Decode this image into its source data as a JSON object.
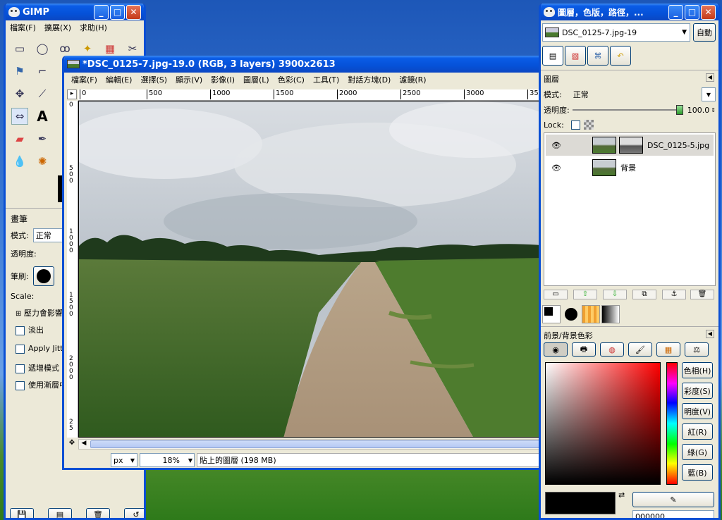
{
  "toolbox": {
    "title": "GIMP",
    "menu": [
      "檔案(F)",
      "擴展(X)",
      "求助(H)"
    ],
    "tool_icons": [
      "rect-select-icon",
      "ellipse-select-icon",
      "lasso-icon",
      "fuzzy-select-icon",
      "color-select-icon",
      "scissors-icon",
      "move-icon",
      "align-icon",
      "crop-icon",
      "rotate-icon",
      "scale-icon",
      "shear-icon",
      "flip-icon",
      "text-icon",
      "bucket-fill-icon",
      "blend-icon",
      "pencil-icon",
      "paintbrush-icon",
      "eraser-icon",
      "airbrush-icon",
      "ink-icon",
      "clone-icon",
      "heal-icon",
      "smudge-icon",
      "dodge-icon",
      "blur-icon",
      "measure-icon",
      "zoom-icon"
    ],
    "tool_options": {
      "title": "畫筆",
      "mode_label": "模式:",
      "mode_value": "正常",
      "opacity_label": "透明度:",
      "brush_label": "筆刷:",
      "scale_label": "Scale:",
      "pressure_label": "壓力會影響",
      "fade_label": "淡出",
      "jitter_label": "Apply Jitte",
      "incremental_label": "遞增模式",
      "color_from_gradient_label": "使用漸層中"
    }
  },
  "image_window": {
    "title": "*DSC_0125-7.jpg-19.0 (RGB, 3 layers) 3900x2613",
    "menu": [
      "檔案(F)",
      "編輯(E)",
      "選擇(S)",
      "顯示(V)",
      "影像(I)",
      "圖層(L)",
      "色彩(C)",
      "工具(T)",
      "對話方塊(D)",
      "濾鏡(R)"
    ],
    "ruler_ticks": [
      "0",
      "500",
      "1000",
      "1500",
      "2000",
      "2500",
      "3000",
      "35"
    ],
    "ruler_v_ticks": [
      "0",
      "5\n0\n0",
      "1\n0\n0\n0",
      "1\n5\n0\n0",
      "2\n0\n0\n0",
      "2\n5"
    ],
    "unit": "px",
    "zoom": "18%",
    "status": "貼上的圖層 (198 MB)"
  },
  "layers_dock": {
    "title": "圖層，色版，路徑，...",
    "image_select": "DSC_0125-7.jpg-19",
    "auto_button": "自動",
    "panel_title": "圖層",
    "mode_label": "模式:",
    "mode_value": "正常",
    "opacity_label": "透明度:",
    "opacity_value": "100.0",
    "opacity_fraction": 1.0,
    "lock_label": "Lock:",
    "layers": [
      {
        "name": "DSC_0125-5.jpg",
        "visible": true,
        "selected": true
      },
      {
        "name": "背景",
        "visible": true,
        "selected": false
      }
    ],
    "fg_bg_title": "前景/背景色彩",
    "color_buttons": [
      "色相(H)",
      "彩度(S)",
      "明度(V)",
      "紅(R)",
      "綠(G)",
      "藍(B)"
    ],
    "hex_value": "000000"
  },
  "colors": {
    "xp_blue": "#0a4fd4",
    "panel_bg": "#ece9d8",
    "fg_color": "#000000",
    "bg_color": "#ffffff"
  }
}
